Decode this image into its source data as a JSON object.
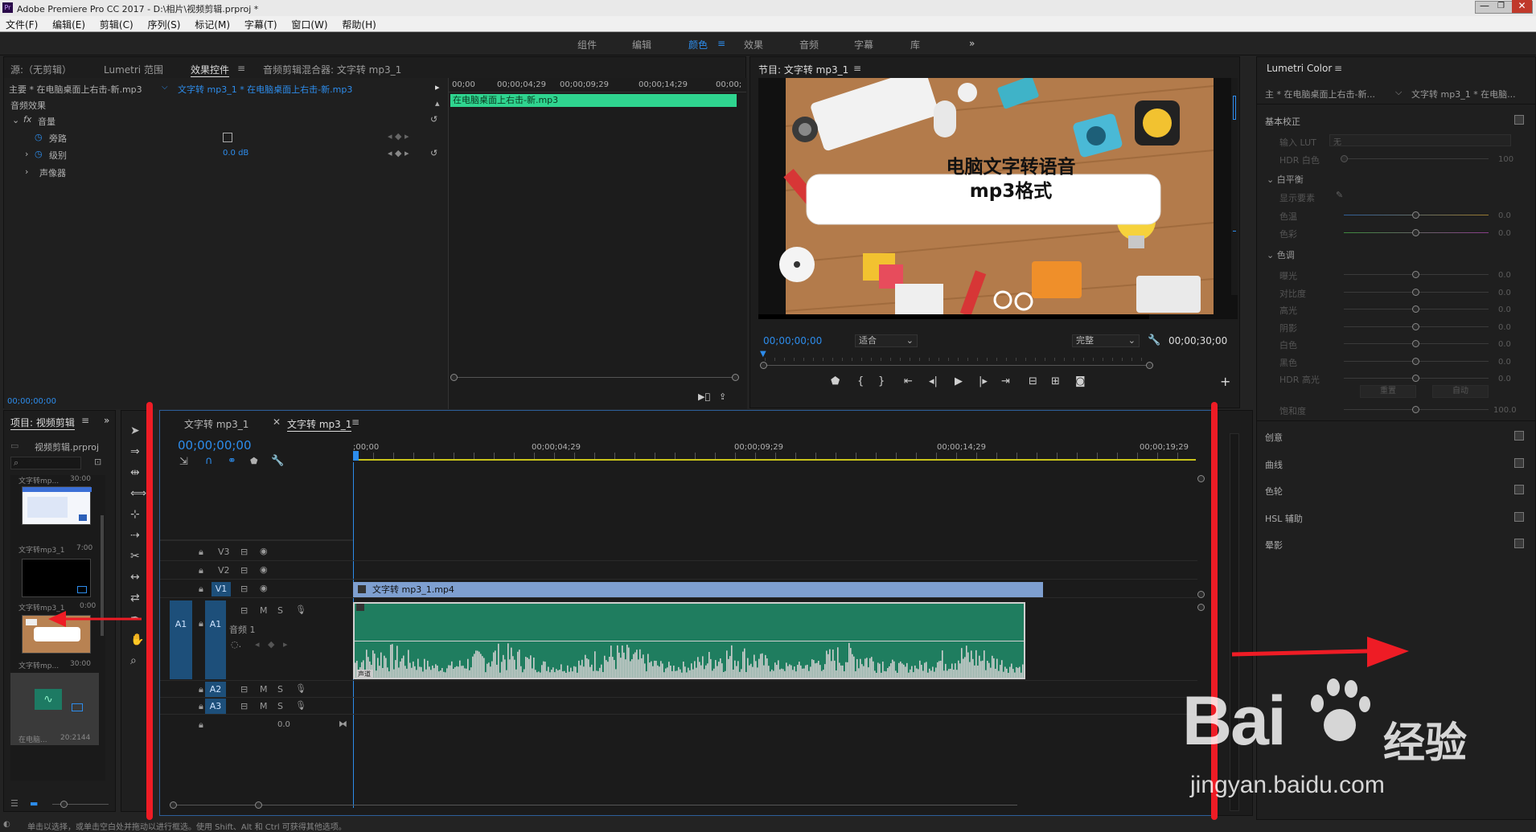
{
  "title_bar": {
    "app_title": "Adobe Premiere Pro CC 2017 - D:\\相片\\视频剪辑.prproj *"
  },
  "menu": {
    "items": [
      "文件(F)",
      "编辑(E)",
      "剪辑(C)",
      "序列(S)",
      "标记(M)",
      "字幕(T)",
      "窗口(W)",
      "帮助(H)"
    ]
  },
  "workspaces": {
    "items": [
      "组件",
      "编辑",
      "颜色",
      "效果",
      "音频",
      "字幕",
      "库"
    ],
    "active": "颜色",
    "more": "»"
  },
  "source_panel": {
    "tabs": [
      "源:（无剪辑）",
      "Lumetri 范围",
      "效果控件",
      "音频剪辑混合器: 文字转 mp3_1"
    ],
    "active_tab": "效果控件",
    "master_clip": "主要 * 在电脑桌面上右击-新.mp3",
    "sequence_clip": "文字转 mp3_1 * 在电脑桌面上右击-新.mp3",
    "section": "音频效果",
    "effect_name": "音量",
    "params": [
      {
        "name": "旁路",
        "value": ""
      },
      {
        "name": "级别",
        "value": "0.0 dB"
      }
    ],
    "panner": "声像器",
    "ruler_times": [
      "00;00",
      "00;00;04;29",
      "00;00;09;29",
      "00;00;14;29",
      "00;00;"
    ],
    "clip_label": "在电脑桌面上右击-新.mp3",
    "timecode": "00;00;00;00"
  },
  "program_panel": {
    "title": "节目: 文字转 mp3_1",
    "video_text": [
      "电脑文字转语音",
      "mp3格式"
    ],
    "timecode": "00;00;00;00",
    "fit": "适合",
    "quality": "完整",
    "duration": "00;00;30;00"
  },
  "project_panel": {
    "title": "项目: 视频剪辑",
    "project_file": "视频剪辑.prproj",
    "items": [
      {
        "name": "文字转mp...",
        "duration": "30:00"
      },
      {
        "name": "文字转mp3_1",
        "duration": "7:00"
      },
      {
        "name": "文字转mp3_1",
        "duration": "0:00"
      },
      {
        "name": "文字转mp...",
        "duration": "30:00"
      },
      {
        "name": "在电脑...",
        "duration": "20:2144"
      }
    ]
  },
  "timeline": {
    "tabs": [
      "文字转 mp3_1",
      "文字转 mp3_1"
    ],
    "active_tab": 1,
    "timecode": "00;00;00;00",
    "ruler": [
      ";00;00",
      "00;00;04;29",
      "00;00;09;29",
      "00;00;14;29",
      "00;00;19;29"
    ],
    "video_tracks": [
      "V3",
      "V2",
      "V1"
    ],
    "audio_tracks": [
      "A1",
      "A2",
      "A3"
    ],
    "audio_track_name": "音频 1",
    "video_clip": "文字转 mp3_1.mp4",
    "audio_clip_label": "声道",
    "master_value": "0.0"
  },
  "lumetri": {
    "title": "Lumetri Color",
    "master": "主 * 在电脑桌面上右击-新...",
    "sequence": "文字转 mp3_1 * 在电脑...",
    "basic": "基本校正",
    "lut_label": "输入 LUT",
    "lut_value": "无",
    "hdr_white": {
      "label": "HDR 白色",
      "value": "100"
    },
    "white_balance": "白平衡",
    "eyedropper": "显示要素",
    "wb": [
      {
        "label": "色温",
        "value": "0.0"
      },
      {
        "label": "色彩",
        "value": "0.0"
      }
    ],
    "tone": "色调",
    "tone_rows": [
      {
        "label": "曝光",
        "value": "0.0"
      },
      {
        "label": "对比度",
        "value": "0.0"
      },
      {
        "label": "高光",
        "value": "0.0"
      },
      {
        "label": "阴影",
        "value": "0.0"
      },
      {
        "label": "白色",
        "value": "0.0"
      },
      {
        "label": "黑色",
        "value": "0.0"
      },
      {
        "label": "HDR 高光",
        "value": "0.0"
      }
    ],
    "buttons": [
      "重置",
      "自动"
    ],
    "saturation": {
      "label": "饱和度",
      "value": "100.0"
    },
    "sections": [
      "创意",
      "曲线",
      "色轮",
      "HSL 辅助",
      "晕影"
    ]
  },
  "status_bar": {
    "text": "单击以选择，或单击空白处并拖动以进行框选。使用 Shift、Alt 和 Ctrl 可获得其他选项。"
  },
  "watermark": {
    "brand": "Bai",
    "brand2": "du",
    "cn": "经验",
    "url": "jingyan.baidu.com"
  }
}
